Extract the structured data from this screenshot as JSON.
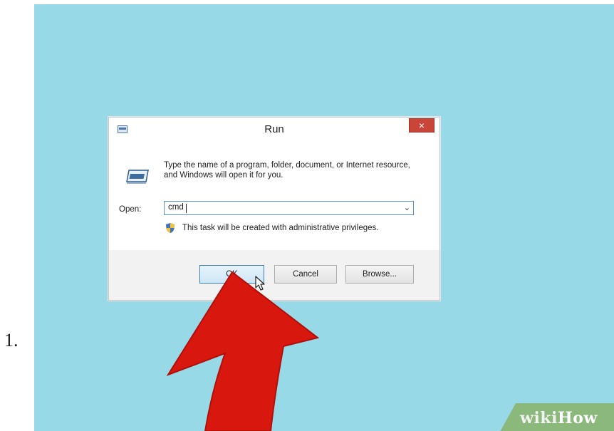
{
  "step": {
    "number": "1."
  },
  "dialog": {
    "title": "Run",
    "close_label": "×",
    "description": "Type the name of a program, folder, document, or Internet resource, and Windows will open it for you.",
    "open_label": "Open:",
    "open_value": "cmd",
    "admin_note": "This task will be created with administrative privileges.",
    "buttons": {
      "ok": "OK",
      "cancel": "Cancel",
      "browse": "Browse..."
    }
  },
  "watermark": {
    "prefix": "wiki",
    "suffix": "How"
  },
  "colors": {
    "desktop_bg": "#97d9e7",
    "close_button": "#c9453a",
    "arrow": "#d8170f",
    "focus_border": "#5a8fd6"
  },
  "icons": [
    "run-icon",
    "shield-icon",
    "mouse-cursor-icon",
    "close-icon",
    "red-arrow"
  ]
}
